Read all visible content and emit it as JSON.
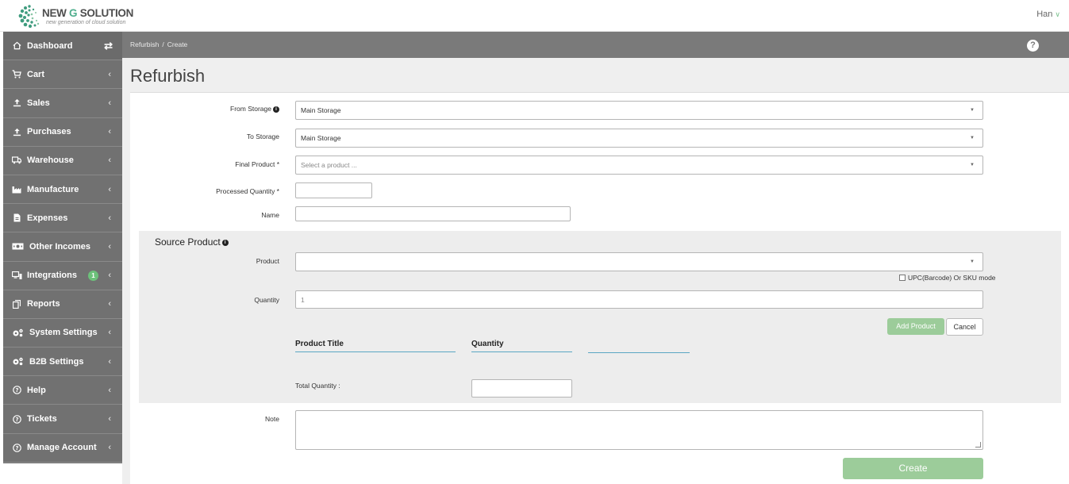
{
  "brand": {
    "title_main": "NEW ",
    "title_accent": "G",
    "title_end": " SOLUTION",
    "tagline": "new generation of cloud solution"
  },
  "user": {
    "name": "Han"
  },
  "sidebar": {
    "items": [
      {
        "label": "Dashboard",
        "icon": "home-icon"
      },
      {
        "label": "Cart",
        "icon": "cart-icon"
      },
      {
        "label": "Sales",
        "icon": "upload-icon"
      },
      {
        "label": "Purchases",
        "icon": "upload-icon"
      },
      {
        "label": "Warehouse",
        "icon": "truck-icon"
      },
      {
        "label": "Manufacture",
        "icon": "factory-icon"
      },
      {
        "label": "Expenses",
        "icon": "file-icon"
      },
      {
        "label": "Other Incomes",
        "icon": "money-icon"
      },
      {
        "label": "Integrations",
        "icon": "devices-icon",
        "badge": "1"
      },
      {
        "label": "Reports",
        "icon": "copy-icon"
      },
      {
        "label": "System Settings",
        "icon": "cogs-icon"
      },
      {
        "label": "B2B Settings",
        "icon": "cogs-icon"
      },
      {
        "label": "Help",
        "icon": "question-icon"
      },
      {
        "label": "Tickets",
        "icon": "question-icon"
      },
      {
        "label": "Manage Account",
        "icon": "question-icon"
      }
    ]
  },
  "breadcrumb": {
    "parent": "Refurbish",
    "separator": "/",
    "current": "Create"
  },
  "page": {
    "title": "Refurbish"
  },
  "form": {
    "from_storage": {
      "label": "From Storage",
      "value": "Main Storage"
    },
    "to_storage": {
      "label": "To Storage",
      "value": "Main Storage"
    },
    "final_product": {
      "label": "Final Product *",
      "placeholder": "Select a product ..."
    },
    "processed_quantity": {
      "label": "Processed Quantity *",
      "value": ""
    },
    "name": {
      "label": "Name",
      "value": ""
    },
    "source": {
      "title": "Source Product",
      "product_label": "Product",
      "product_value": "",
      "upc_label": "UPC(Barcode) Or SKU mode",
      "quantity_label": "Quantity",
      "quantity_placeholder": "1",
      "add_button": "Add Product",
      "cancel_button": "Cancel",
      "columns": [
        "Product Title",
        "Quantity",
        ""
      ],
      "total_label": "Total Quantity :",
      "total_value": ""
    },
    "note": {
      "label": "Note",
      "value": ""
    },
    "submit": "Create"
  }
}
